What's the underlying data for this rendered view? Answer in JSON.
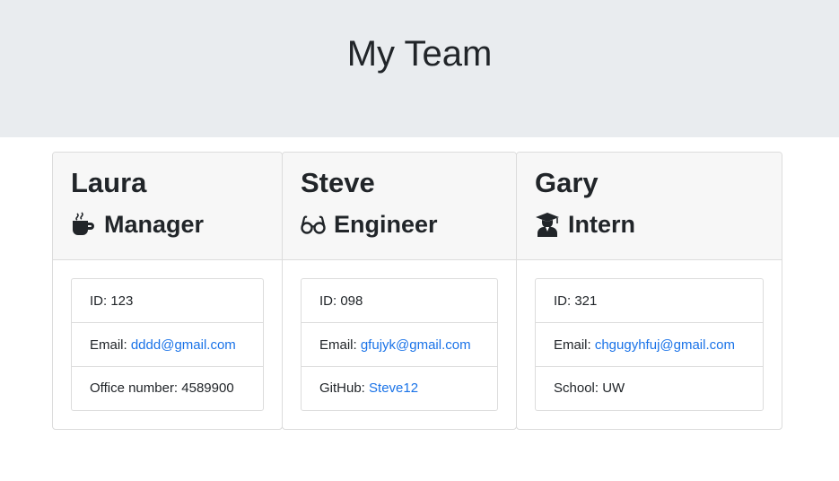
{
  "header": {
    "title": "My Team"
  },
  "cards": [
    {
      "name": "Laura",
      "role": "Manager",
      "role_icon": "coffee-mug-icon",
      "id_label": "ID: ",
      "id_value": "123",
      "email_label": "Email: ",
      "email_value": "dddd@gmail.com",
      "extra_label": "Office number: ",
      "extra_value": "4589900"
    },
    {
      "name": "Steve",
      "role": "Engineer",
      "role_icon": "glasses-icon",
      "id_label": "ID: ",
      "id_value": "098",
      "email_label": "Email: ",
      "email_value": "gfujyk@gmail.com",
      "extra_label": "GitHub: ",
      "extra_value": "Steve12"
    },
    {
      "name": "Gary",
      "role": "Intern",
      "role_icon": "graduate-icon",
      "id_label": "ID: ",
      "id_value": "321",
      "email_label": "Email: ",
      "email_value": "chgugyhfuj@gmail.com",
      "extra_label": "School: ",
      "extra_value": "UW"
    }
  ],
  "colors": {
    "header_bg": "#e9ecef",
    "card_header_bg": "#f7f7f7",
    "link": "#1a73e8"
  }
}
